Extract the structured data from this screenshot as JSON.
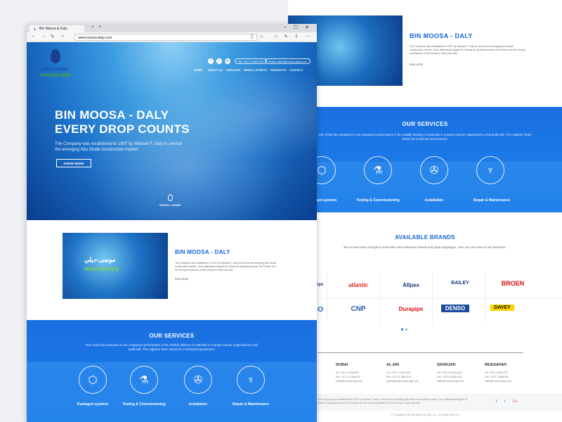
{
  "browser": {
    "tab_title": "Bin Moosa & Daly",
    "url": "www.moosa-daly.com",
    "close_glyph": "×",
    "new_tab_glyph": "+",
    "min_glyph": "–",
    "max_glyph": "☐",
    "win_close_glyph": "✕"
  },
  "logo": {
    "arabic": "موسى-ديلي",
    "english": "moosa-daly"
  },
  "header": {
    "social": [
      "f",
      "t",
      "G+"
    ],
    "phone": "Tel: +971 2 6421720",
    "email": "Email: sales@moosa-daly.com",
    "nav": [
      "HOME",
      "ABOUT US",
      "SERVICES",
      "NEWS & EVENTS",
      "PRODUCTS",
      "CONTACT"
    ]
  },
  "hero": {
    "line1": "BIN MOOSA - DALY",
    "line2": "EVERY DROP COUNTS",
    "subtitle": "The Company was established in 1907 by Michael F. Daly to service the emerging Abu Dhabi construction market",
    "button": "KNOW MORE",
    "scroll": "SCROLL DOWN"
  },
  "about": {
    "title": "BIN MOOSA - DALY",
    "text": "The Company was established in 1907 by Michael F. Daly to service the emerging Abu Dhabi construction market. Soon afterwards Sayyah M. Moosa Al Qusbeisi became his Partner and the strong foundations of Bin Moosa & Daly were laid.",
    "more": "READ MORE"
  },
  "services": {
    "title": "OUR SERVICES",
    "text": "One of the key measures in our company's performance is the reliable delivery of materials in a timely manner supported by a full audit trail. The Logistics Team strives for Continual Improvement.",
    "items": [
      {
        "label": "Packaged systems",
        "icon": "box-icon",
        "glyph": "⬡"
      },
      {
        "label": "Testing & Commissioning",
        "icon": "flask-icon",
        "glyph": "⚗"
      },
      {
        "label": "Installation",
        "icon": "drill-icon",
        "glyph": "✇"
      },
      {
        "label": "Repair & Maintenance",
        "icon": "wrench-icon",
        "glyph": "♆"
      }
    ],
    "right_labels": [
      "ckaged systems",
      "Testing & Commissioning",
      "Installation",
      "Repair & Maintenance"
    ]
  },
  "brands": {
    "title": "AVAILABLE BRANDS",
    "text": "We've been lucky enough to work with some awesome brands and great campaigns. Here are just a few of our favourites.",
    "row1": [
      "amps",
      "atlantic",
      "Allpex",
      "BAILEY",
      "BROEN"
    ],
    "row2": [
      "CO",
      "CNP",
      "Durapipe",
      "DENSO",
      "DAVEY"
    ],
    "colors": {
      "atlantic": "#e2231a",
      "allpex": "#1a3c7a",
      "bailey": "#1a3c7a",
      "broen": "#d40d12",
      "cnp": "#2a5fa8",
      "durapipe": "#d40d12",
      "denso": "#1b4a9c",
      "davey": "#111111",
      "davey_bg": "#ffd400"
    }
  },
  "footer": {
    "cities": [
      {
        "name": "DUBAI",
        "lines": [
          "Tel: +971 4 3289978",
          "Fax: +971 4 3289474",
          "sales@moosa-daly.com"
        ]
      },
      {
        "name": "AL AIN",
        "lines": [
          "Tel: +971 3 7660 630",
          "Fax: +971 3 7660 613",
          "salesalain@moosa-daly.com"
        ]
      },
      {
        "name": "SHARJAH",
        "lines": [
          "Tel: +971 6 5338 4415",
          "Fax: +971 6 5338 444",
          "sales@moosa-daly.com"
        ]
      },
      {
        "name": "MUSSAFAH",
        "lines": [
          "Tel: +971 2 5551737",
          "Fax: +971 2 5508209",
          "sales@moosa-daly.com"
        ]
      }
    ],
    "about": "The Company was established in 1907 by Michael F. Daly to service the emerging Abu Dhabi construction market. Soon afterwards Sayyah M. Moosa Al Qusbeisi became his Partner and the strong foundations of Bin Moosa & Daly were laid.",
    "social": [
      "f",
      "t",
      "G+"
    ],
    "copyright": "© Copyright 2016 Bin Moosa & Daly LLC - All rights reserved"
  },
  "colors": {
    "brand_blue": "#1565d8",
    "logo_green": "#4fa335"
  }
}
